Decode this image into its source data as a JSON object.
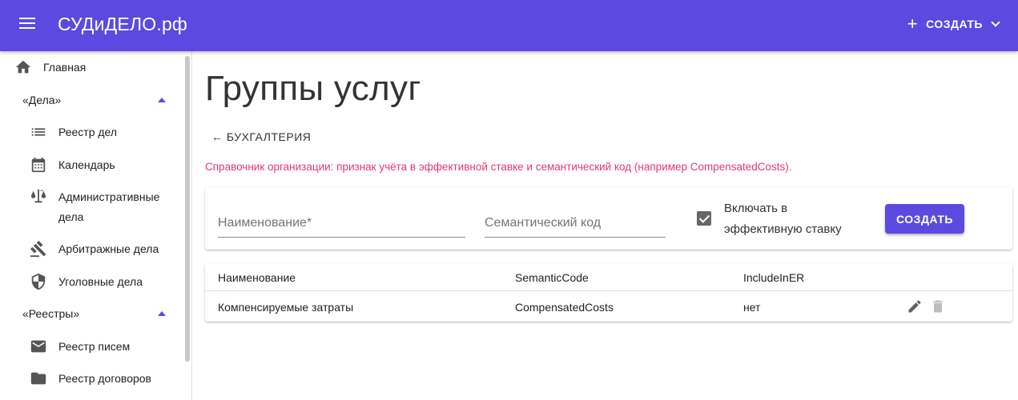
{
  "appbar": {
    "title": "СУДиДЕЛО.рф",
    "create_label": "СОЗДАТЬ"
  },
  "sidebar": {
    "home": "Главная",
    "sections": [
      {
        "label": "«Дела»",
        "items": [
          {
            "label": "Реестр дел",
            "icon": "list-icon"
          },
          {
            "label": "Календарь",
            "icon": "calendar-icon"
          },
          {
            "label": "Административные",
            "label2": "дела",
            "icon": "scales-icon"
          },
          {
            "label": "Арбитражные дела",
            "icon": "gavel-icon"
          },
          {
            "label": "Уголовные дела",
            "icon": "shield-icon"
          }
        ]
      },
      {
        "label": "«Реестры»",
        "items": [
          {
            "label": "Реестр писем",
            "icon": "mail-icon"
          },
          {
            "label": "Реестр договоров",
            "icon": "folder-icon"
          }
        ]
      }
    ]
  },
  "main": {
    "title": "Группы услуг",
    "back_link": "← БУХГАЛТЕРИЯ",
    "hint": "Справочник организации: признак учёта в эффективной ставке и семантический код (например CompensatedCosts).",
    "form": {
      "name_placeholder": "Наименование*",
      "code_placeholder": "Семантический код",
      "include_label": "Включать в эффективную ставку",
      "include_checked": true,
      "submit_label": "СОЗДАТЬ"
    },
    "table": {
      "headers": [
        "Наименование",
        "SemanticCode",
        "IncludeInER"
      ],
      "rows": [
        {
          "name": "Компенсируемые затраты",
          "code": "CompensatedCosts",
          "include": "нет"
        }
      ]
    }
  },
  "colors": {
    "primary": "#5c4ae0",
    "hint": "#e33a6b"
  }
}
